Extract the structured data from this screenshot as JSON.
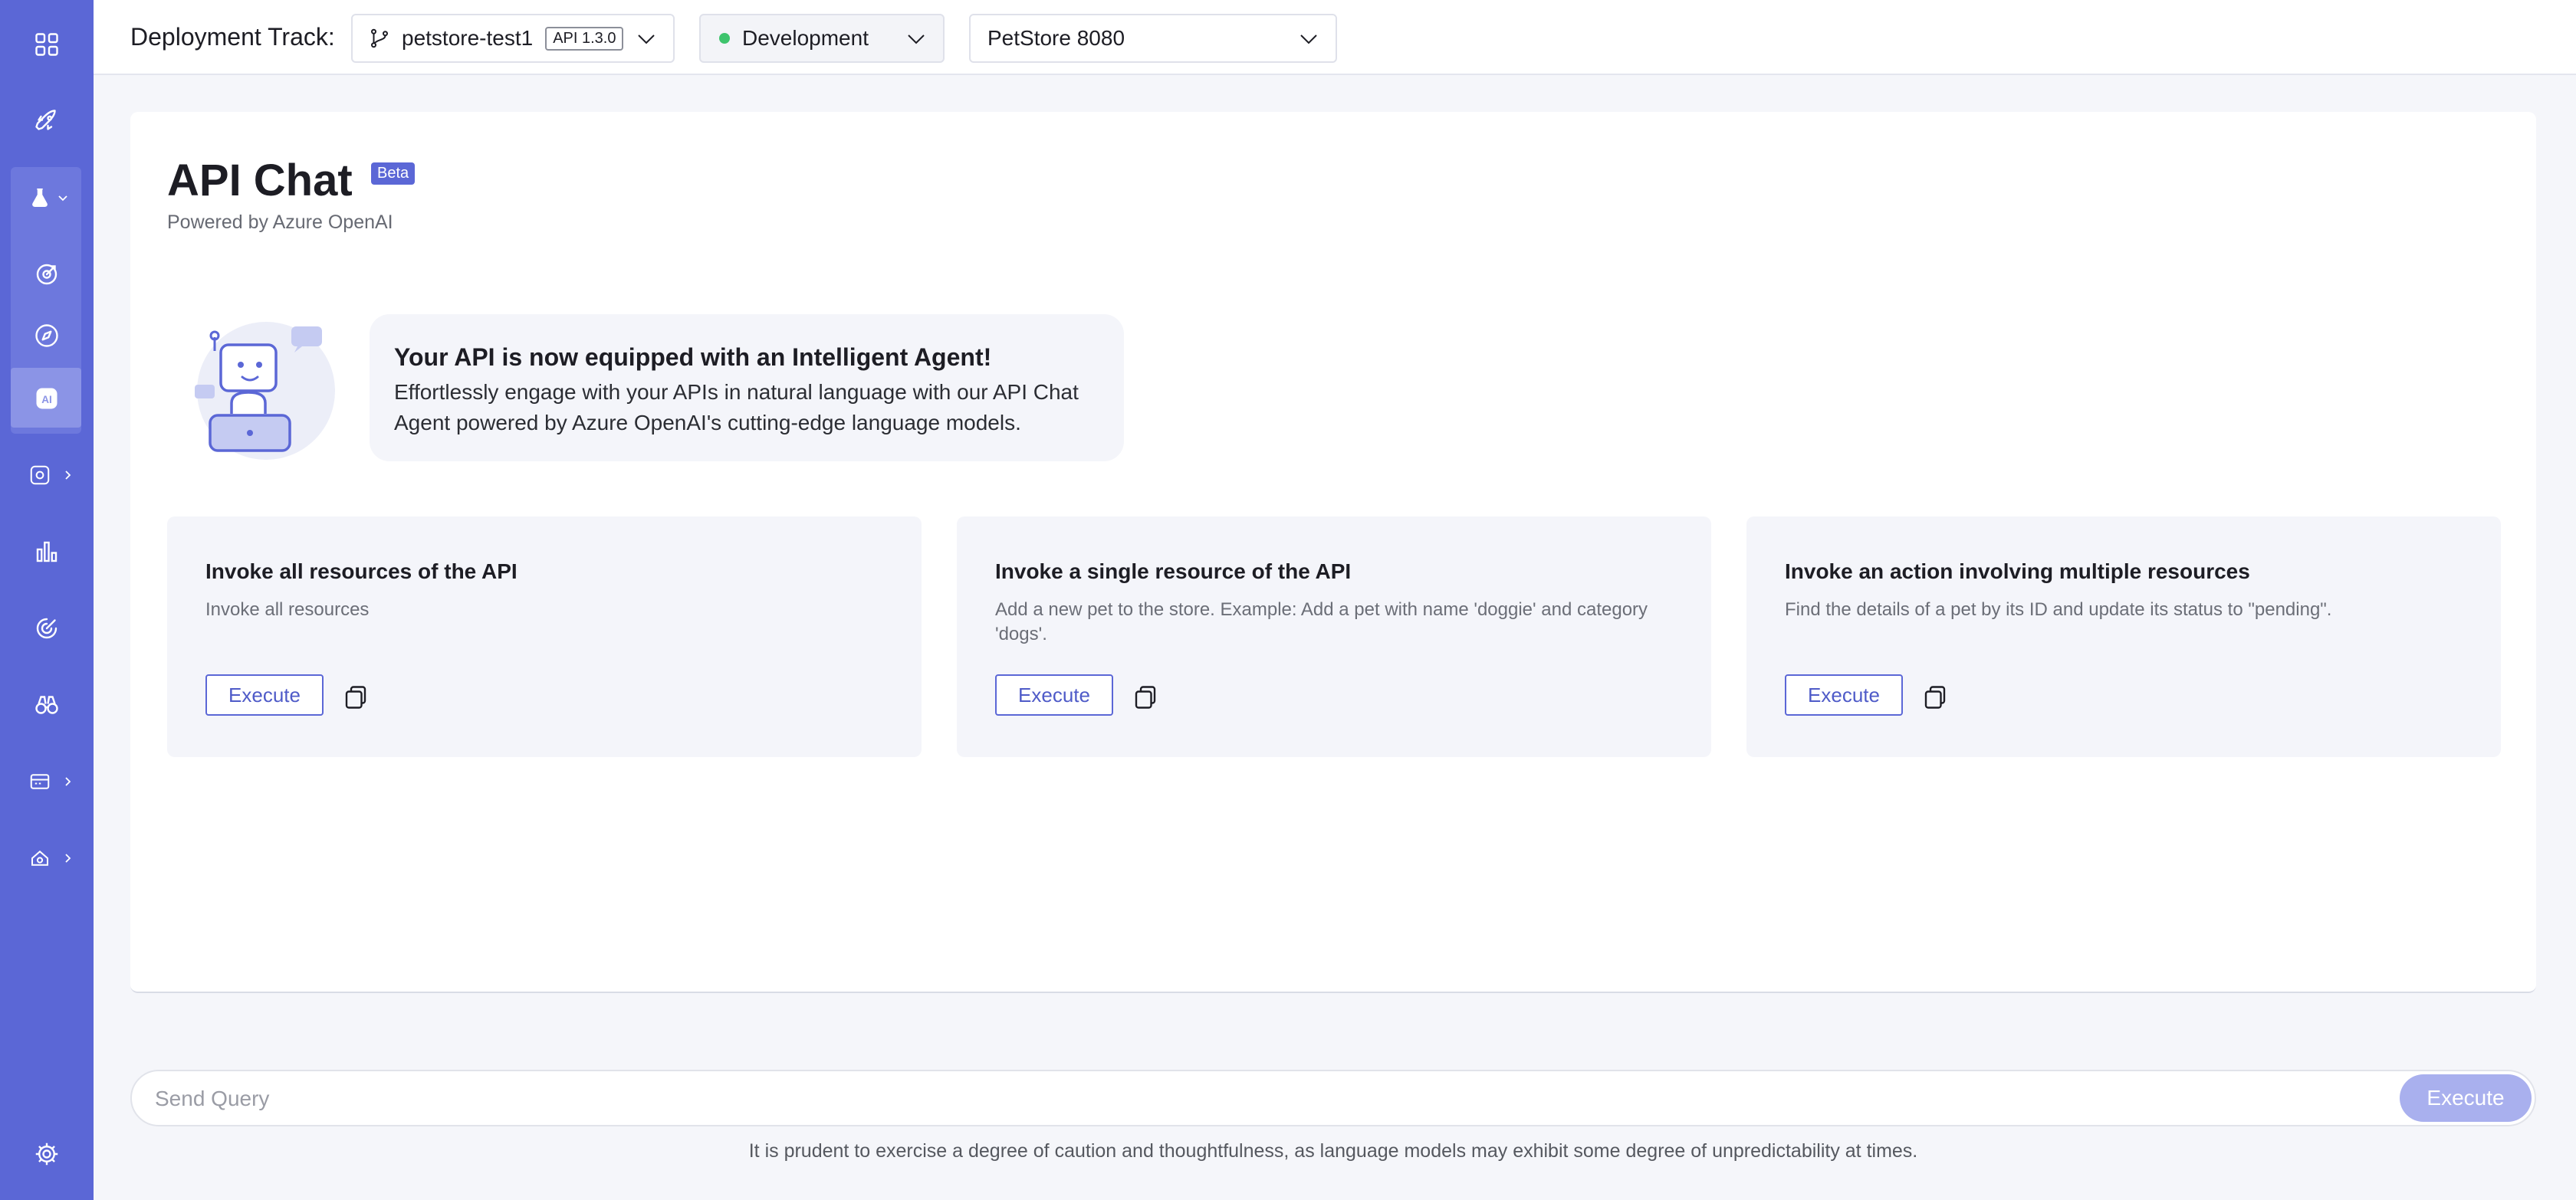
{
  "header": {
    "title": "Deployment Track:",
    "branch": {
      "name": "petstore-test1",
      "version": "API 1.3.0"
    },
    "environment": {
      "name": "Development",
      "status_color": "#3ec46d"
    },
    "server": {
      "name": "PetStore 8080"
    }
  },
  "sidebar": {
    "icons": [
      "grid-icon",
      "rocket-icon",
      "flask-icon",
      "target-icon",
      "compass-icon",
      "ai-icon",
      "settings-gear-icon",
      "bar-chart-icon",
      "radar-icon",
      "binoculars-icon",
      "database-icon",
      "cloud-gear-icon",
      "gear-icon"
    ],
    "active": "ai-icon",
    "ai_label": "AI"
  },
  "main": {
    "title": "API Chat",
    "badge": "Beta",
    "subtitle": "Powered by Azure OpenAI",
    "agent": {
      "title": "Your API is now equipped with an Intelligent Agent!",
      "description": "Effortlessly engage with your APIs in natural language with our API Chat Agent powered by Azure OpenAI's cutting-edge language models."
    },
    "cards": [
      {
        "title": "Invoke all resources of the API",
        "description": "Invoke all resources",
        "button": "Execute"
      },
      {
        "title": "Invoke a single resource of the API",
        "description": "Add a new pet to the store. Example: Add a pet with name 'doggie' and category 'dogs'.",
        "button": "Execute"
      },
      {
        "title": "Invoke an action involving multiple resources",
        "description": "Find the details of a pet by its ID and update its status to \"pending\".",
        "button": "Execute"
      }
    ]
  },
  "query": {
    "placeholder": "Send Query",
    "button": "Execute",
    "disclaimer": "It is prudent to exercise a degree of caution and thoughtfulness, as language models may exhibit some degree of unpredictability at times."
  },
  "colors": {
    "sidebar": "#5b67d6",
    "accent": "#5b67d6",
    "status_green": "#3ec46d"
  }
}
